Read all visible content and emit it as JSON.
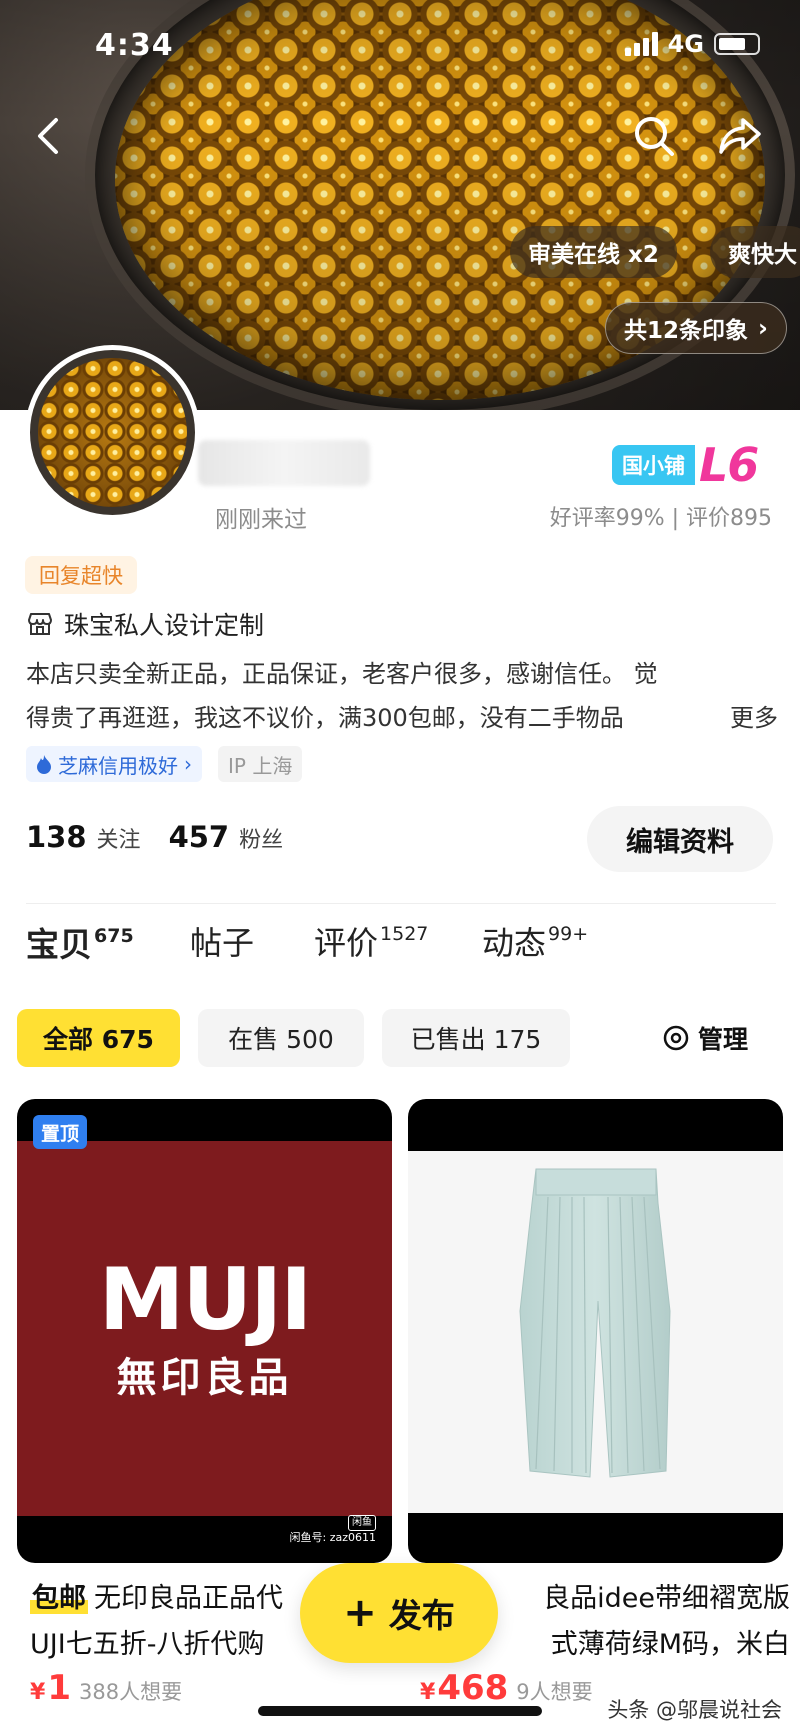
{
  "status_bar": {
    "time": "4:34",
    "network": "4G"
  },
  "banner": {
    "tags": [
      "审美在线 x2",
      "爽快大"
    ],
    "impressions": "共12条印象",
    "impressions_chevron": "›"
  },
  "shop": {
    "last_seen": "刚刚来过",
    "level_tag": "国小铺",
    "level": "L6",
    "rating": "好评率99% | 评价895",
    "reply_badge": "回复超快",
    "category": "珠宝私人设计定制",
    "description_line1": "本店只卖全新正品，正品保证，老客户很多，感谢信任。 觉",
    "description_line2": "得贵了再逛逛，我这不议价，满300包邮，没有二手物品",
    "more": "更多",
    "credit_chip": "芝麻信用极好",
    "credit_chevron": "›",
    "ip_chip": "IP 上海",
    "following_count": "138",
    "following_label": "关注",
    "followers_count": "457",
    "followers_label": "粉丝",
    "edit_label": "编辑资料"
  },
  "tabs": [
    {
      "label": "宝贝",
      "count": "675"
    },
    {
      "label": "帖子",
      "count": ""
    },
    {
      "label": "评价",
      "count": "1527"
    },
    {
      "label": "动态",
      "count": "99+"
    }
  ],
  "filters": {
    "all": "全部 675",
    "on_sale": "在售 500",
    "sold": "已售出 175",
    "manage": "管理"
  },
  "products": [
    {
      "badge": "置顶",
      "image_text_en": "MUJI",
      "image_text_cn": "無印良品",
      "watermark_logo": "闲鱼",
      "watermark_id": "闲鱼号: zaz0611",
      "free_shipping": "包邮",
      "title_line1": "无印良品正品代",
      "title_line2": "UJI七五折-八折代购",
      "currency": "¥",
      "price": "1",
      "wants": "388人想要"
    },
    {
      "title_line1": "良品idee带细褶宽版",
      "title_line2": "式薄荷绿M码，米白",
      "currency": "¥",
      "price": "468",
      "wants": "9人想要"
    }
  ],
  "publish": {
    "plus": "+",
    "label": "发布"
  },
  "source_watermark": "头条 @邬晨说社会",
  "colors": {
    "accent": "#ffe033",
    "price": "#ff3b3b",
    "level": "#f0379c",
    "level_tag": "#38c6f2",
    "badge_blue": "#2f7ff0"
  }
}
